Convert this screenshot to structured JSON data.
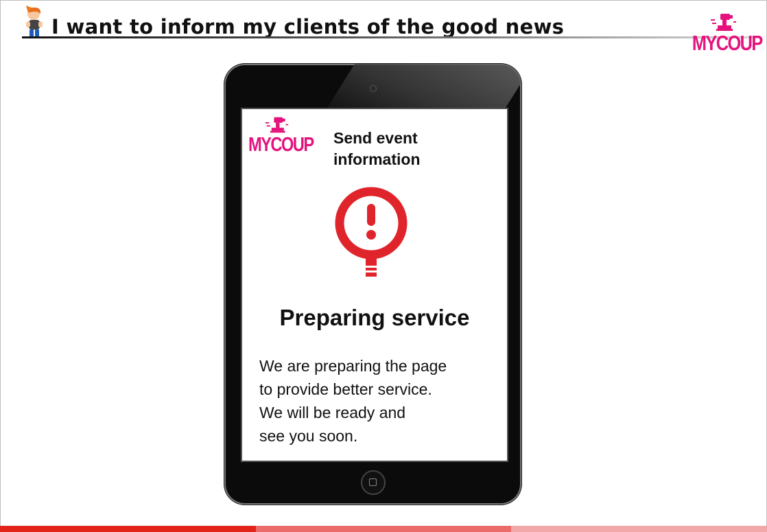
{
  "header": {
    "title": "I want to inform my clients of the good news"
  },
  "brand": {
    "logo_text": "MYCOUP",
    "logo_icon": "fist-stamp-icon",
    "color": "#e5127d"
  },
  "screen": {
    "heading_line1": "Send event",
    "heading_line2": "information",
    "alert_icon": "exclamation-warning-icon",
    "alert_color": "#e0242b",
    "status_title": "Preparing service",
    "message_lines": [
      "We are preparing the page",
      "to provide better service.",
      "We will be ready and",
      "see you soon."
    ]
  },
  "footer": {
    "bar_colors": [
      "#e2231a",
      "#eb6b6b",
      "#f2a8a8"
    ]
  }
}
